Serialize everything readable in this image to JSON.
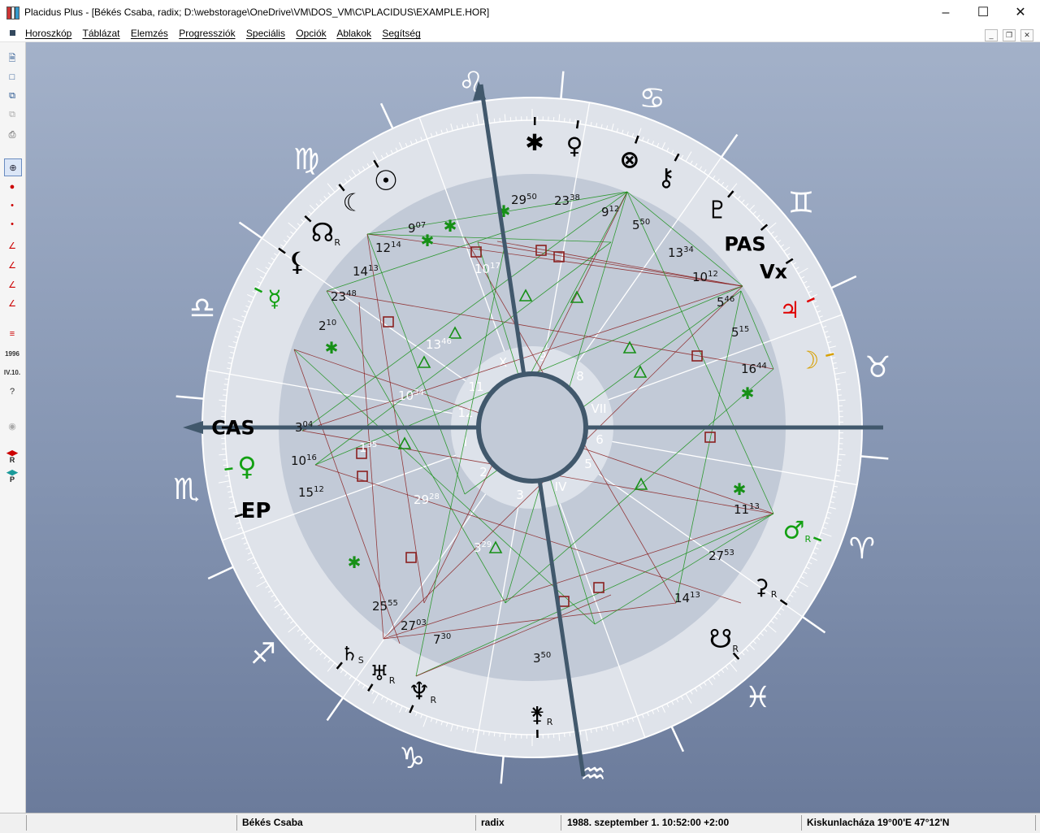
{
  "window": {
    "title": "Placidus Plus - [Békés Csaba,  radix;   D:\\webstorage\\OneDrive\\VM\\DOS_VM\\C\\PLACIDUS\\EXAMPLE.HOR]"
  },
  "menu": [
    "Horoszkóp",
    "Táblázat",
    "Elemzés",
    "Progressziók",
    "Speciális",
    "Opciók",
    "Ablakok",
    "Segítség"
  ],
  "toolbar": {
    "year_label": "1996",
    "date_label": "IV.10.",
    "r_label": "R",
    "p_label": "P"
  },
  "status": {
    "name": "Békés Csaba",
    "type": "radix",
    "datetime": "1988. szeptember 1.  10:52:00 +2:00",
    "place": "Kiskunlacháza  19°00'E  47°12'N"
  },
  "chart": {
    "houses": [
      "9",
      "8",
      "VII",
      "6",
      "5",
      "IV",
      "3",
      "2",
      "I",
      "12",
      "11",
      "X"
    ],
    "zodiac": [
      {
        "glyph": "♌",
        "a": 100
      },
      {
        "glyph": "♋",
        "a": 70
      },
      {
        "glyph": "♊",
        "a": 40
      },
      {
        "glyph": "♉",
        "a": 10
      },
      {
        "glyph": "♈",
        "a": -20
      },
      {
        "glyph": "♓",
        "a": -50
      },
      {
        "glyph": "♒",
        "a": -80
      },
      {
        "glyph": "♑",
        "a": -110
      },
      {
        "glyph": "♐",
        "a": -140
      },
      {
        "glyph": "♏",
        "a": -170
      },
      {
        "glyph": "♎",
        "a": 160
      },
      {
        "glyph": "♍",
        "a": 130
      }
    ],
    "cusps": [
      {
        "label": "29",
        "sup": "50"
      },
      {
        "label": "23",
        "sup": "38"
      },
      {
        "label": "9",
        "sup": "12"
      },
      {
        "label": "5",
        "sup": "50"
      },
      {
        "label": "13",
        "sup": "34"
      },
      {
        "label": "10",
        "sup": "12"
      },
      {
        "label": "5",
        "sup": "46"
      },
      {
        "label": "5",
        "sup": "15"
      },
      {
        "label": "16",
        "sup": "44"
      },
      {
        "label": "11",
        "sup": "13"
      },
      {
        "label": "27",
        "sup": "53"
      },
      {
        "label": "14",
        "sup": "13"
      },
      {
        "label": "3",
        "sup": "50"
      },
      {
        "label": "7",
        "sup": "30"
      },
      {
        "label": "27",
        "sup": "03"
      },
      {
        "label": "25",
        "sup": "55"
      },
      {
        "label": "15",
        "sup": "12"
      },
      {
        "label": "10",
        "sup": "16"
      },
      {
        "label": "3",
        "sup": "04"
      },
      {
        "label": "2",
        "sup": "10"
      },
      {
        "label": "23",
        "sup": "48"
      },
      {
        "label": "14",
        "sup": "13"
      },
      {
        "label": "12",
        "sup": "14"
      },
      {
        "label": "9",
        "sup": "07"
      },
      {
        "label": "10",
        "sup": "17"
      },
      {
        "label": "13",
        "sup": "46"
      },
      {
        "label": "10",
        "sup": "34"
      },
      {
        "label": "1",
        "sup": "35"
      },
      {
        "label": "29",
        "sup": "28"
      },
      {
        "label": "3",
        "sup": "29"
      }
    ],
    "planets": [
      {
        "glyph": "☉",
        "name": "sun",
        "color": "#000000"
      },
      {
        "glyph": "☾",
        "name": "moon-black",
        "color": "#000000"
      },
      {
        "glyph": "☊",
        "name": "north-node",
        "color": "#000000",
        "flag": "R"
      },
      {
        "glyph": "⚷",
        "name": "chiron",
        "color": "#000000"
      },
      {
        "glyph": "⊗",
        "name": "fortune",
        "color": "#000000"
      },
      {
        "glyph": "♀",
        "name": "venus",
        "color": "#000000"
      },
      {
        "glyph": "✱",
        "name": "star",
        "color": "#000000"
      },
      {
        "glyph": "♇",
        "name": "pluto",
        "color": "#000000"
      },
      {
        "glyph": "PAS",
        "name": "pas",
        "color": "#000000"
      },
      {
        "glyph": "Vx",
        "name": "vertex",
        "color": "#000000"
      },
      {
        "glyph": "♃",
        "name": "jupiter",
        "color": "#e00000"
      },
      {
        "glyph": "☽",
        "name": "moon",
        "color": "#d8a000"
      },
      {
        "glyph": "♂",
        "name": "mars",
        "color": "#12a012",
        "flag": "R"
      },
      {
        "glyph": "⚳",
        "name": "ceres",
        "color": "#000000",
        "flag": "R"
      },
      {
        "glyph": "☋",
        "name": "south-node",
        "color": "#000000",
        "flag": "R"
      },
      {
        "glyph": "⚵",
        "name": "juno",
        "color": "#000000",
        "flag": "R"
      },
      {
        "glyph": "♆",
        "name": "neptune",
        "color": "#000000",
        "flag": "R"
      },
      {
        "glyph": "♅",
        "name": "uranus",
        "color": "#000000",
        "flag": "R"
      },
      {
        "glyph": "♄",
        "name": "saturn",
        "color": "#000000",
        "flag": "S"
      },
      {
        "glyph": "EP",
        "name": "ep",
        "color": "#000000"
      },
      {
        "glyph": "♀",
        "name": "venus-green",
        "color": "#12a012"
      },
      {
        "glyph": "CAS",
        "name": "cas",
        "color": "#000000"
      },
      {
        "glyph": "☿",
        "name": "mercury",
        "color": "#12a012"
      },
      {
        "glyph": "⚸",
        "name": "lilith",
        "color": "#000000"
      }
    ]
  }
}
